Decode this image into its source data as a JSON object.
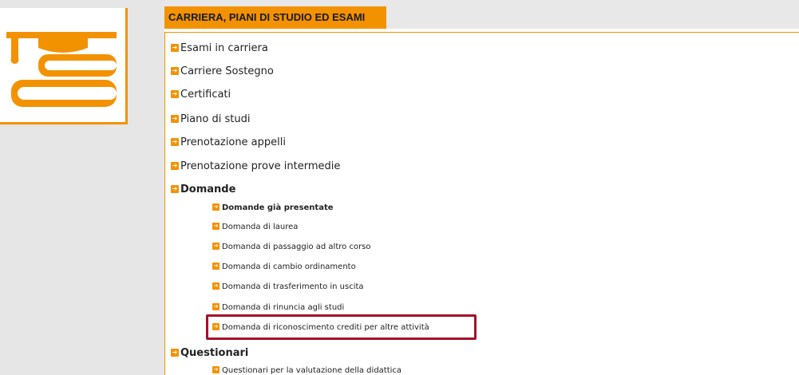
{
  "section_title": "CARRIERA, PIANI DI STUDIO ED ESAMI",
  "icons": {
    "logo": "graduation-books-icon",
    "bullet": "arrow-right-icon"
  },
  "colors": {
    "accent": "#f39200",
    "highlight_border": "#a5112a"
  },
  "menu": {
    "esami_in_carriera": "Esami in carriera",
    "carriere_sostegno": "Carriere Sostegno",
    "certificati": "Certificati",
    "piano_di_studi": "Piano di studi",
    "prenotazione_appelli": "Prenotazione appelli",
    "prenotazione_prove": "Prenotazione prove intermedie",
    "domande": {
      "label": "Domande",
      "items": [
        "Domande già presentate",
        "Domanda di laurea",
        "Domanda di passaggio ad altro corso",
        "Domanda di cambio ordinamento",
        "Domanda di trasferimento in uscita",
        "Domanda di rinuncia agli studi",
        "Domanda di riconoscimento crediti per altre attività"
      ]
    },
    "questionari": {
      "label": "Questionari",
      "items": [
        "Questionari per la valutazione della didattica"
      ]
    }
  }
}
